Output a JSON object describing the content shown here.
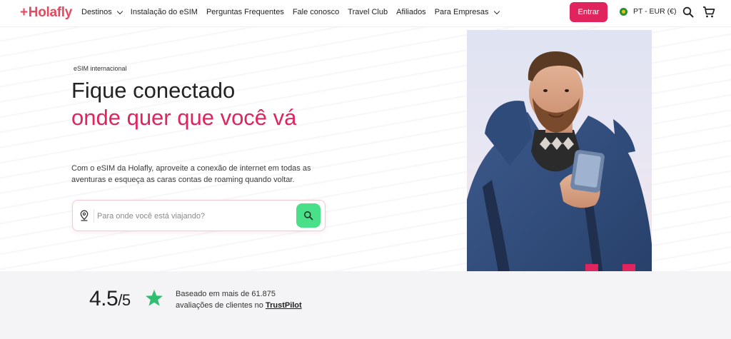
{
  "header": {
    "logo": "Holafly",
    "nav": [
      {
        "label": "Destinos",
        "dropdown": true
      },
      {
        "label": "Instalação do eSIM",
        "dropdown": false
      },
      {
        "label": "Perguntas Frequentes",
        "dropdown": false
      },
      {
        "label": "Fale conosco",
        "dropdown": false
      },
      {
        "label": "Travel Club",
        "dropdown": false
      },
      {
        "label": "Afiliados",
        "dropdown": false
      },
      {
        "label": "Para Empresas",
        "dropdown": true
      }
    ],
    "login_label": "Entrar",
    "locale": "PT - EUR (€)",
    "icons": [
      "search-icon",
      "cart-icon",
      "brazil-flag-icon",
      "chevron-down-icon"
    ]
  },
  "hero": {
    "eyebrow": "eSIM internacional",
    "title_line1": "Fique conectado",
    "title_highlight": "onde quer que você vá",
    "subtitle": "Com o eSIM da Holafly, aproveite a conexão de internet em todas as aventuras e esqueça as caras contas de roaming quando voltar.",
    "search_placeholder": "Para onde você está viajando?"
  },
  "rating": {
    "score": "4.5",
    "max": "/5",
    "text_line1": "Baseado em mais de 61.875",
    "text_line2_prefix": "avaliações de clientes no ",
    "platform": "TrustPilot"
  },
  "colors": {
    "brand_pink": "#e0245e",
    "accent_green": "#4ae08a",
    "star_green": "#2fbf71",
    "rating_band": "#f4f4f6"
  }
}
